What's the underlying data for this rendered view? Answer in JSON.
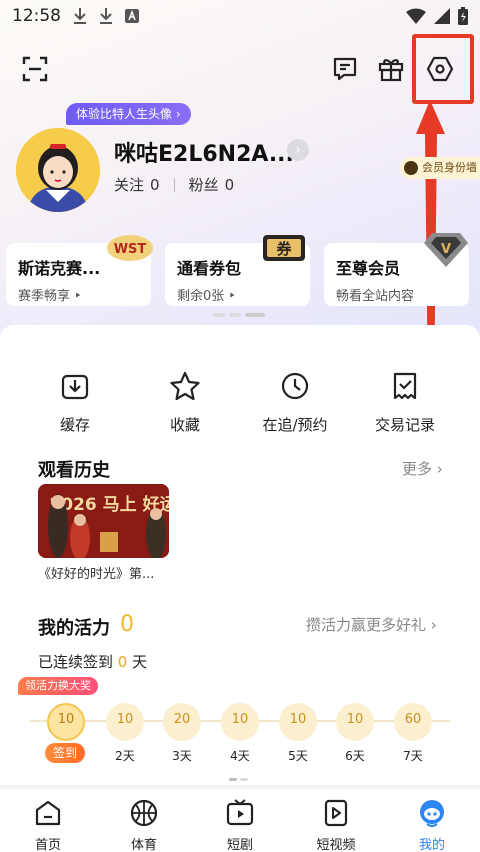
{
  "status_bar": {
    "time": "12:58"
  },
  "profile": {
    "avatar_tag": "体验比特人生头像 ›",
    "name": "咪咕E2L6N2A...",
    "follow_label": "关注",
    "follow_count": "0",
    "fans_label": "粉丝",
    "fans_count": "0",
    "id_wall": "会员身份墙"
  },
  "benefit_cards": [
    {
      "title": "斯诺克赛...",
      "sub": "赛季畅享 ‣",
      "badge": "WST"
    },
    {
      "title": "通看券包",
      "sub": "剩余0张 ‣",
      "badge": "券"
    },
    {
      "title": "至尊会员",
      "sub": "畅看全站内容",
      "badge": "V"
    }
  ],
  "quick_actions": [
    {
      "label": "缓存",
      "icon": "download-icon"
    },
    {
      "label": "收藏",
      "icon": "star-icon"
    },
    {
      "label": "在追/预约",
      "icon": "clock-icon"
    },
    {
      "label": "交易记录",
      "icon": "receipt-check-icon"
    }
  ],
  "history": {
    "title": "观看历史",
    "more": "更多 ›",
    "items": [
      {
        "caption": "《好好的时光》第...",
        "thumb_text": "2026 马上 好运"
      }
    ]
  },
  "vitality": {
    "title": "我的活力",
    "value": "0",
    "earn_link": "攒活力赢更多好礼 ›",
    "signin_prefix": "已连续签到",
    "signin_days": "0",
    "signin_suffix": "天",
    "reward_tag": "领活力换大奖",
    "signin_button": "签到",
    "days": [
      {
        "value": "10",
        "label": ""
      },
      {
        "value": "10",
        "label": "2天"
      },
      {
        "value": "20",
        "label": "3天"
      },
      {
        "value": "10",
        "label": "4天"
      },
      {
        "value": "10",
        "label": "5天"
      },
      {
        "value": "10",
        "label": "6天"
      },
      {
        "value": "60",
        "label": "7天"
      }
    ]
  },
  "bottom_nav": [
    {
      "label": "首页",
      "icon": "home-icon"
    },
    {
      "label": "体育",
      "icon": "basketball-icon"
    },
    {
      "label": "短剧",
      "icon": "tv-play-icon"
    },
    {
      "label": "短视频",
      "icon": "video-play-icon"
    },
    {
      "label": "我的",
      "icon": "mascot-icon"
    }
  ],
  "colors": {
    "accent_red": "#e53a25",
    "accent_blue": "#2a86f0",
    "gold": "#f5b828"
  }
}
